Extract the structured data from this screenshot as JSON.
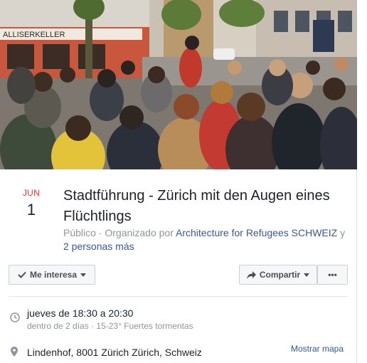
{
  "event": {
    "month": "JUN",
    "day": "1",
    "title": "Stadtführung - Zürich mit den Augen eines Flüchtlings",
    "privacy": "Público",
    "organized_by_prefix": "· Organizado por",
    "organizer": "Architecture for Refugees SCHWEIZ",
    "and_prefix": "y",
    "more_people": "2 personas más"
  },
  "cover": {
    "shop_sign": "ALLISERKELLER",
    "alt_icon": "photo-icon"
  },
  "actions": {
    "interested_label": "Me interesa",
    "share_label": "Compartir",
    "more_label": "•••"
  },
  "details": {
    "time": "jueves de 18:30 a 20:30",
    "time_sub": "dentro de 2 días · 15-23° Fuertes tormentas",
    "location": "Lindenhof, 8001 Zürich Zürich, Schweiz",
    "map_link": "Mostrar mapa"
  },
  "colors": {
    "date_accent": "#e9322f",
    "link": "#365899"
  }
}
